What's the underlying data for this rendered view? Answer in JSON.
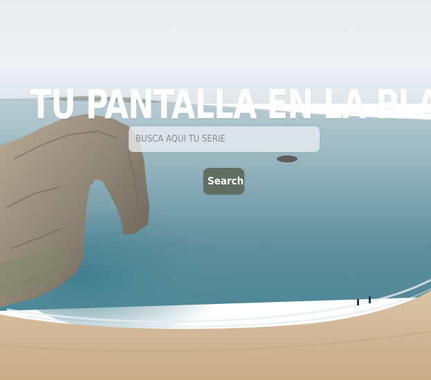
{
  "hero": {
    "title": "TU PANTALLA EN LA PLAYA."
  },
  "search": {
    "placeholder": "BUSCA AQUÍ TU SERIE",
    "value": "",
    "button_label": "Search"
  },
  "colors": {
    "title_text": "#ffffff",
    "button_bg": "#5f6d62",
    "button_text": "#ffffff",
    "input_bg": "#ebeef0"
  }
}
